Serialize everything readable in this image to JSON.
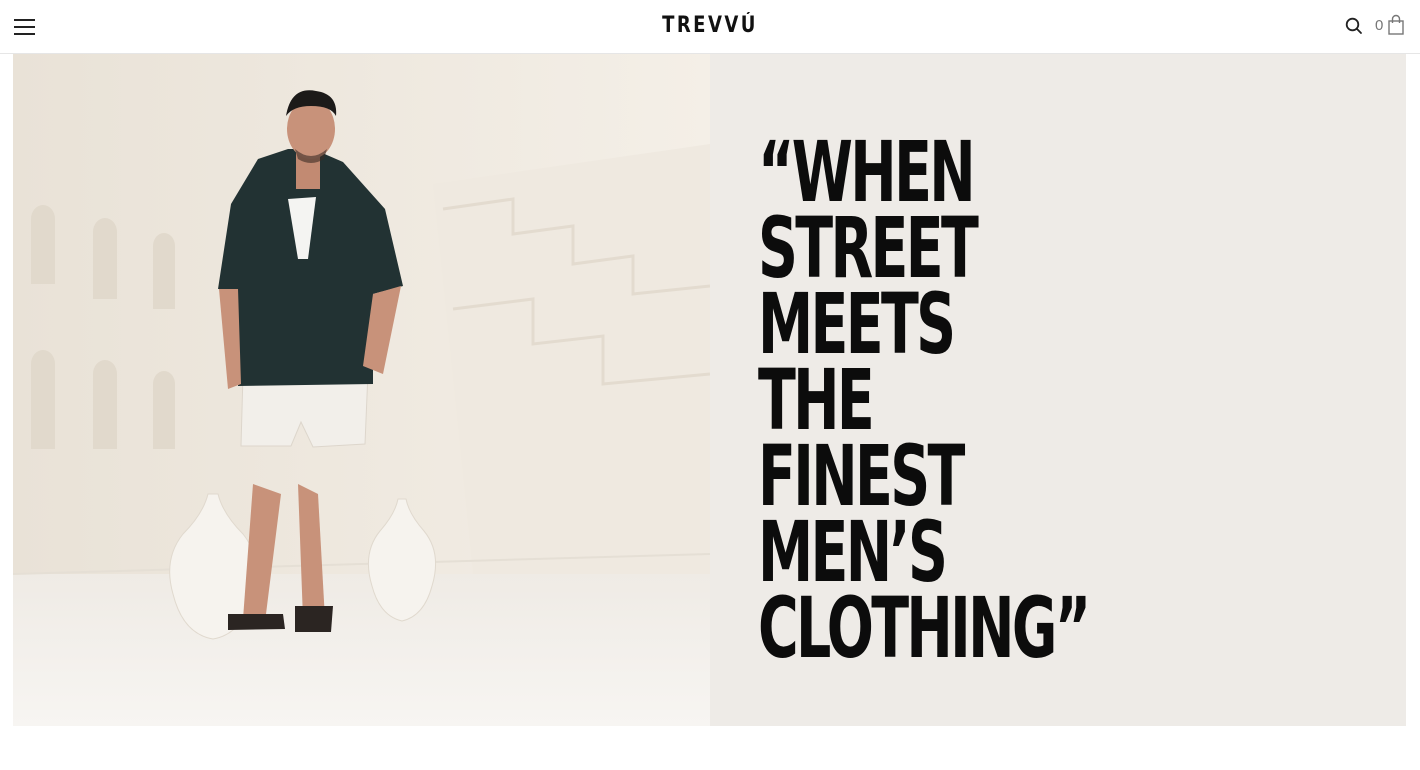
{
  "header": {
    "brand": "TREVVÚ",
    "cart_count": "0",
    "icons": {
      "menu": "hamburger-menu-icon",
      "search": "search-icon",
      "cart": "shopping-bag-icon"
    }
  },
  "hero": {
    "image_alt": "Man in dark short-sleeve camp shirt and white shorts walking in a white courtyard",
    "quote_lines": [
      "“WHEN",
      "STREET",
      "MEETS",
      "THE",
      "FINEST",
      "MEN’S",
      "CLOTHING”"
    ],
    "colors": {
      "panel_background": "#eeebe7",
      "text": "#0c0c0c"
    }
  }
}
